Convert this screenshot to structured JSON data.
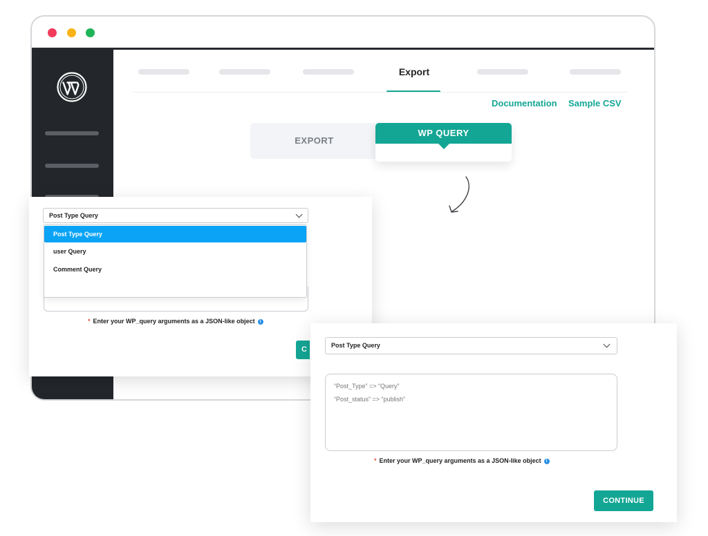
{
  "tabs": {
    "active_label": "Export"
  },
  "links": {
    "documentation": "Documentation",
    "sample_csv": "Sample CSV"
  },
  "segmented": {
    "export_label": "EXPORT",
    "wp_query_label": "WP QUERY"
  },
  "left_panel": {
    "select_value": "Post Type Query",
    "dropdown_options": [
      "Post Type Query",
      "user Query",
      "Comment Query"
    ],
    "selected_option": "Post Type Query",
    "hint": "Enter your WP_query arguments as a JSON-like object",
    "continue_partial": "C"
  },
  "right_panel": {
    "select_value": "Post Type Query",
    "textarea_lines": [
      "“Post_Type” => “Query”",
      "“Post_status” => “publish”"
    ],
    "hint": "Enter your WP_query arguments as a JSON-like object",
    "continue_label": "CONTINUE"
  },
  "icons": {
    "wordpress_logo": "wordpress-logo",
    "info": "info-icon",
    "chevron": "chevron-down-icon",
    "arrow": "curved-arrow-icon"
  },
  "colors": {
    "accent": "#14a695",
    "sidebar": "#23272b",
    "dropdown_selected": "#0aa3f5",
    "required": "#e5573c",
    "info": "#2b8fe6"
  }
}
